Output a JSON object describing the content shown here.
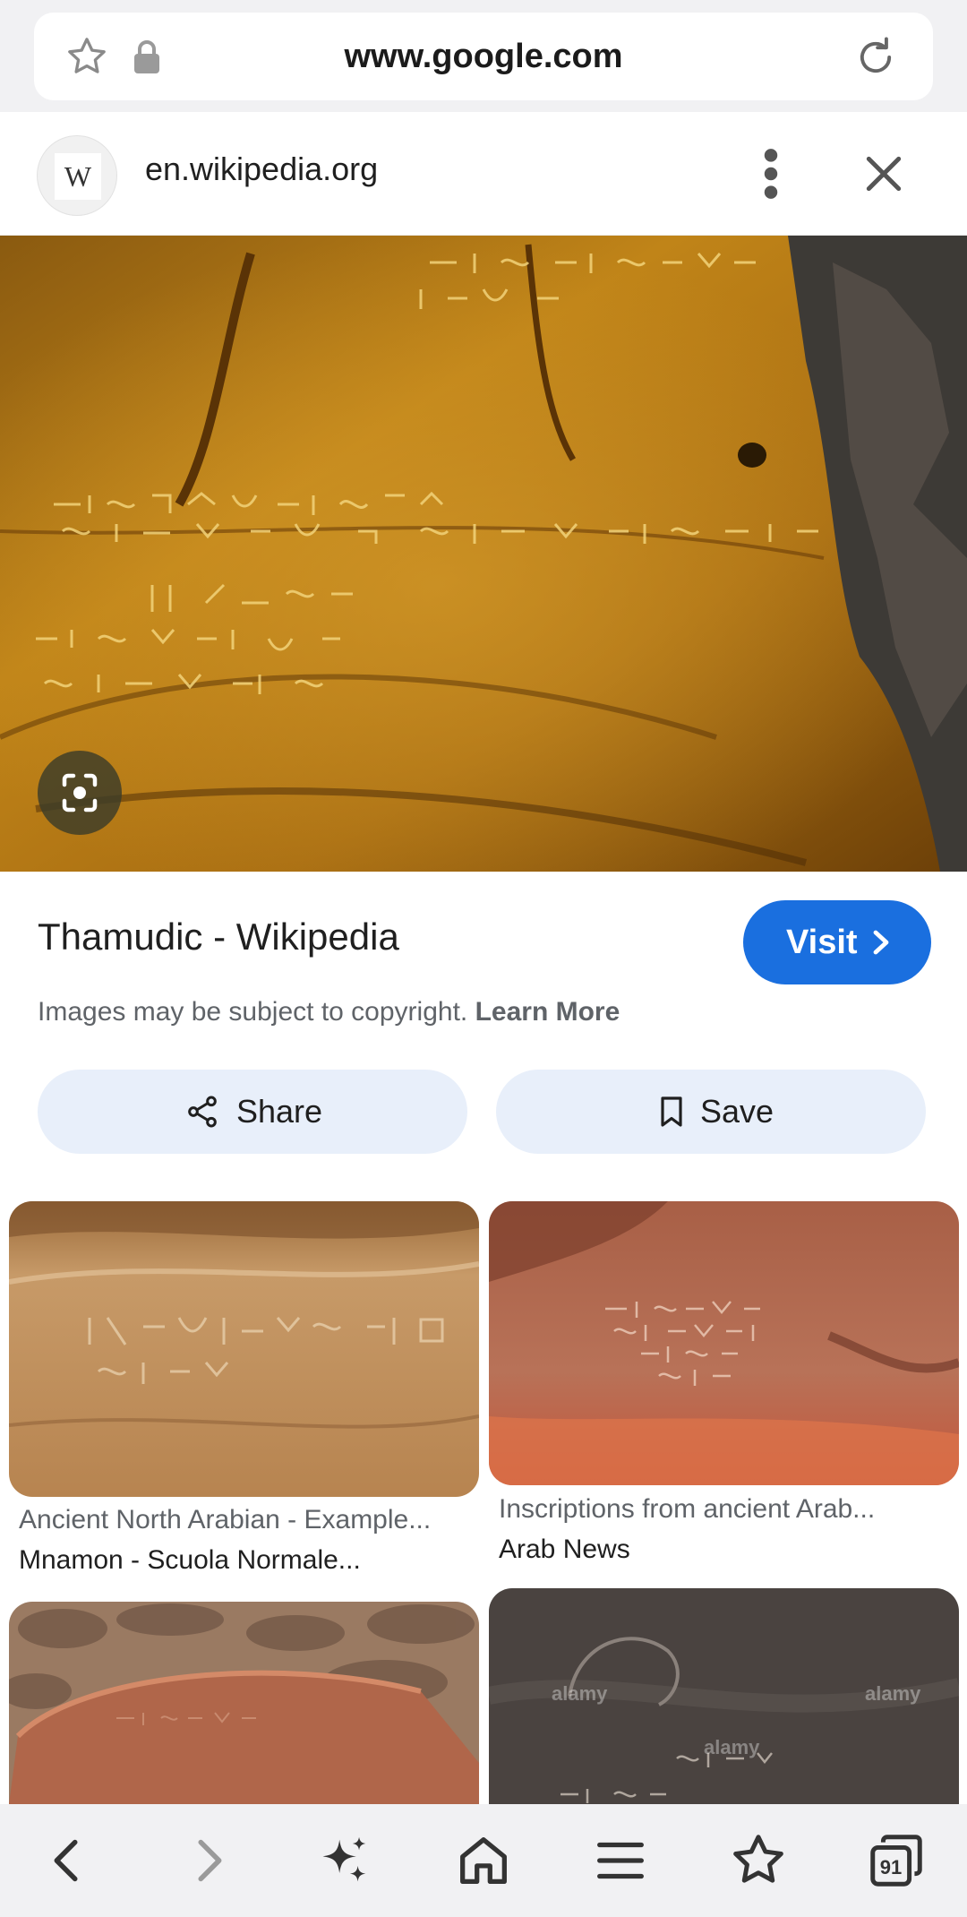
{
  "address_bar": {
    "url": "www.google.com"
  },
  "sheet_header": {
    "site_initial": "W",
    "domain": "en.wikipedia.org"
  },
  "result": {
    "title": "Thamudic - Wikipedia",
    "visit_label": "Visit",
    "copyright_text": "Images may be subject to copyright.",
    "learn_more_label": "Learn More",
    "share_label": "Share",
    "save_label": "Save"
  },
  "related": [
    {
      "title": "Ancient North Arabian - Example...",
      "source": "Mnamon - Scuola Normale..."
    },
    {
      "title": "Inscriptions from ancient Arab...",
      "source": "Arab News"
    }
  ],
  "watermark": "alamy",
  "bottom_nav": {
    "tabs_count": "91"
  },
  "colors": {
    "accent": "#1a6fdf",
    "pill_bg": "#e8effa",
    "bar_bg": "#f1f1f3"
  }
}
